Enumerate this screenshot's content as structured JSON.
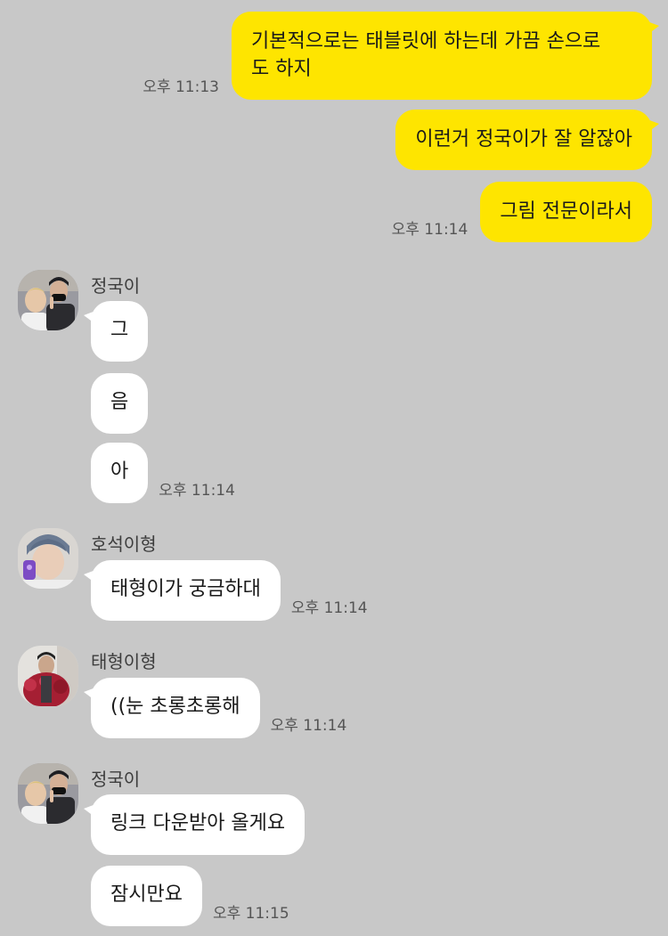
{
  "outgoing": [
    {
      "text_line1": "기본적으로는 태블릿에 하는데 가끔 손으로",
      "text_line2": "도 하지",
      "time": "오후 11:13"
    },
    {
      "text": "이런거 정국이가 잘 알잖아"
    },
    {
      "text": "그림 전문이라서",
      "time": "오후 11:14"
    }
  ],
  "groups": [
    {
      "sender": "정국이",
      "avatar_icon": "profile-photo-two-people",
      "messages": [
        "그",
        "음",
        "아"
      ],
      "time": "오후 11:14"
    },
    {
      "sender": "호석이형",
      "avatar_icon": "profile-photo-person-with-phone",
      "messages": [
        "태형이가 궁금하대"
      ],
      "time": "오후 11:14"
    },
    {
      "sender": "태형이형",
      "avatar_icon": "profile-photo-person-with-flowers",
      "messages": [
        "((눈 초롱초롱해"
      ],
      "time": "오후 11:14"
    },
    {
      "sender": "정국이",
      "avatar_icon": "profile-photo-two-people",
      "messages": [
        "링크 다운받아 올게요",
        "잠시만요"
      ],
      "time": "오후 11:15"
    }
  ],
  "colors": {
    "background": "#c8c8c8",
    "outgoing_bubble": "#fee500",
    "incoming_bubble": "#ffffff"
  }
}
